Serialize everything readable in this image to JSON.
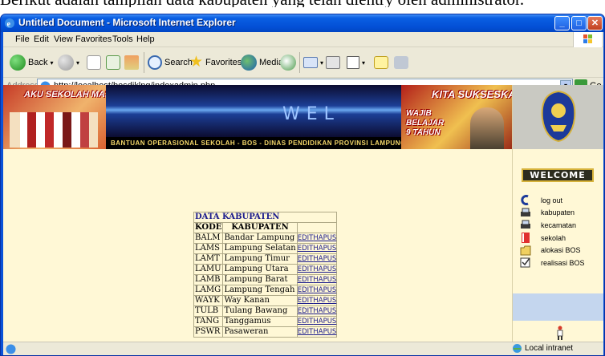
{
  "page_top_text": "Berikut adalah tampilan data kabupaten yang telah dientry oleh administrator.",
  "window": {
    "title": "Untitled Document - Microsoft Internet Explorer"
  },
  "menu": [
    "File",
    "Edit",
    "View",
    "Favorites",
    "Tools",
    "Help"
  ],
  "toolbar": {
    "back": "Back",
    "search": "Search",
    "favorites": "Favorites",
    "media": "Media"
  },
  "address": {
    "label": "Address",
    "url": "http://localhost/bosdiklpg/indexadmin.php",
    "go": "Go"
  },
  "banner": {
    "left_text": "AKU SEKOLAH MASA DEPANKU CERAH...",
    "center_text": "WEL",
    "strip_text": "BANTUAN OPERASIONAL SEKOLAH - BOS - DINAS PENDIDIKAN PROVINSI LAMPUNG",
    "right_text1": "KITA SUKSESKAN",
    "right_text2": "WAJIB BELAJAR 9 TAHUN"
  },
  "sidebar": {
    "welcome": "WELCOME",
    "items": [
      {
        "label": "log out",
        "icon": "logout-icon"
      },
      {
        "label": "kabupaten",
        "icon": "printer-icon"
      },
      {
        "label": "kecamatan",
        "icon": "printer-icon"
      },
      {
        "label": "sekolah",
        "icon": "book-icon"
      },
      {
        "label": "alokasi BOS",
        "icon": "folder-icon"
      },
      {
        "label": "realisasi BOS",
        "icon": "checklist-icon"
      }
    ]
  },
  "table": {
    "caption": "DATA KABUPATEN",
    "headers": [
      "KODE",
      "KABUPATEN"
    ],
    "edit_label": "EDIT",
    "delete_label": "HAPUS",
    "rows": [
      {
        "kode": "BALM",
        "kabupaten": "Bandar Lampung"
      },
      {
        "kode": "LAMS",
        "kabupaten": "Lampung Selatan"
      },
      {
        "kode": "LAMT",
        "kabupaten": "Lampung Timur"
      },
      {
        "kode": "LAMU",
        "kabupaten": "Lampung Utara"
      },
      {
        "kode": "LAMB",
        "kabupaten": "Lampung Barat"
      },
      {
        "kode": "LAMG",
        "kabupaten": "Lampung Tengah"
      },
      {
        "kode": "WAYK",
        "kabupaten": "Way Kanan"
      },
      {
        "kode": "TULB",
        "kabupaten": "Tulang Bawang"
      },
      {
        "kode": "TANG",
        "kabupaten": "Tanggamus"
      },
      {
        "kode": "PSWR",
        "kabupaten": "Pasaweran"
      }
    ]
  },
  "status": {
    "zone": "Local intranet"
  },
  "colors": {
    "titlebar": "#0350d6",
    "content_bg": "#fff8d6",
    "link": "#1c1c8c"
  }
}
